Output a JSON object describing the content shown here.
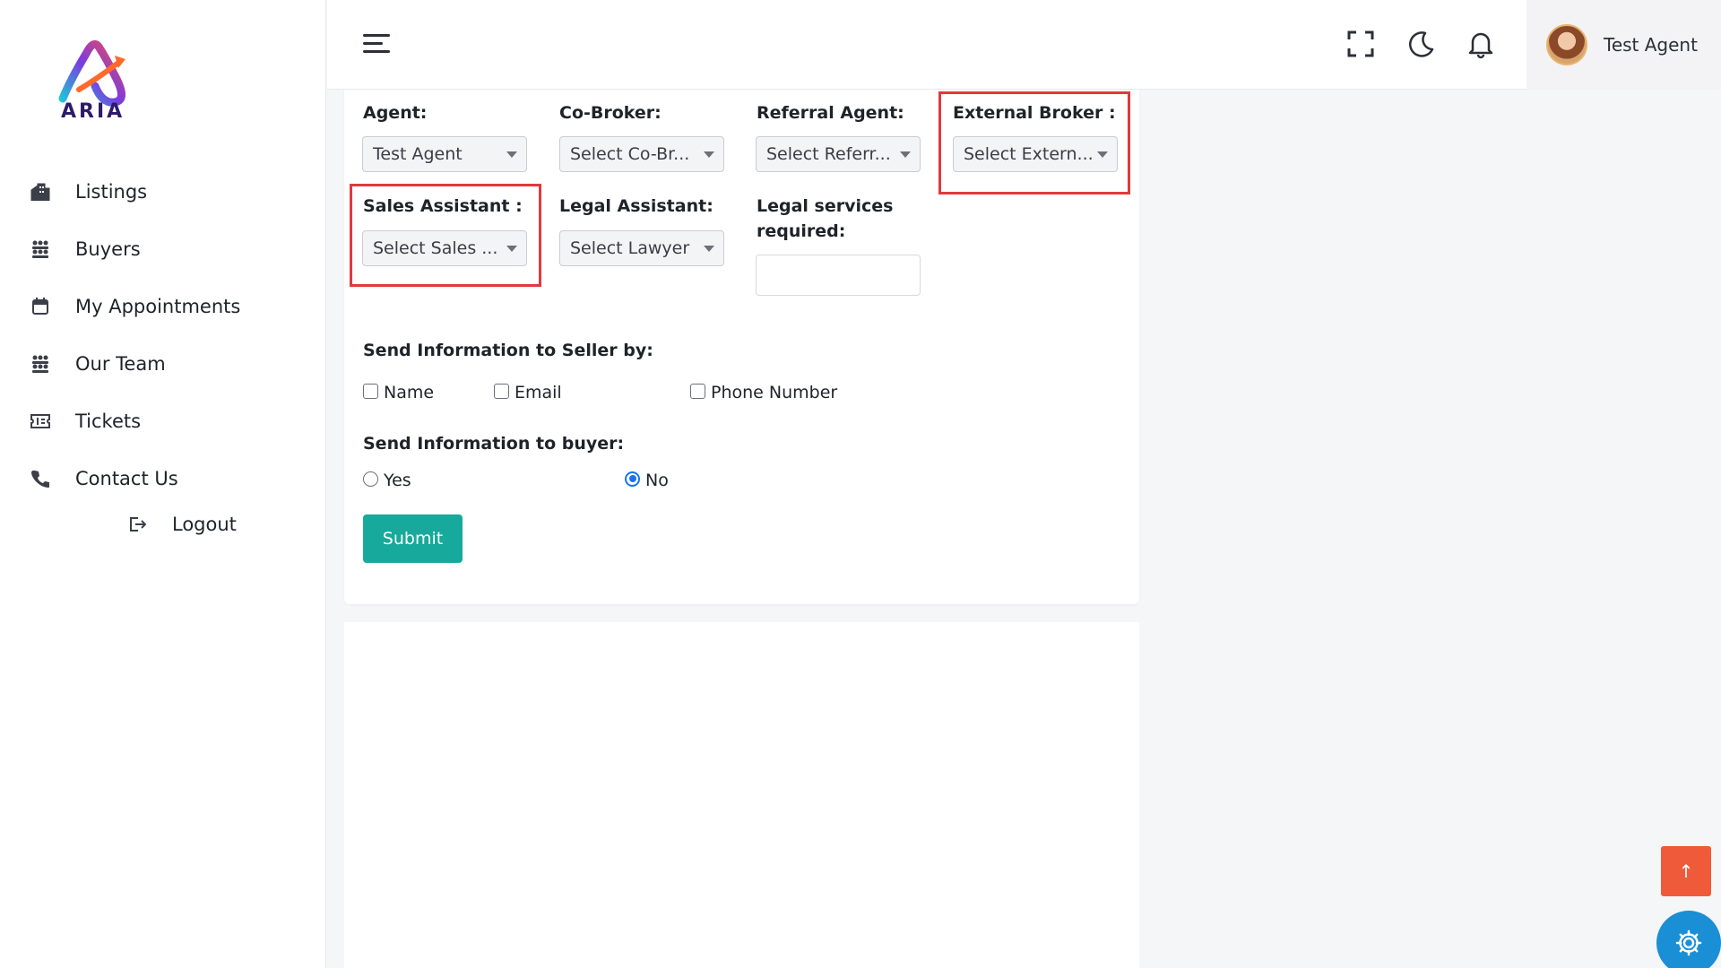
{
  "brand": {
    "logo_text": "ARIA"
  },
  "sidebar": {
    "items": [
      {
        "label": "Listings",
        "icon": "buildings-icon"
      },
      {
        "label": "Buyers",
        "icon": "team-icon"
      },
      {
        "label": "My Appointments",
        "icon": "calendar-icon"
      },
      {
        "label": "Our Team",
        "icon": "team-icon"
      },
      {
        "label": "Tickets",
        "icon": "ticket-icon"
      },
      {
        "label": "Contact Us",
        "icon": "phone-icon"
      }
    ],
    "logout": {
      "label": "Logout",
      "icon": "logout-icon"
    }
  },
  "header": {
    "icons": [
      "menu-icon",
      "fullscreen-icon",
      "moon-icon",
      "bell-icon"
    ],
    "user_name": "Test Agent"
  },
  "form": {
    "agent": {
      "label": "Agent:",
      "value": "Test Agent"
    },
    "co_broker": {
      "label": "Co-Broker:",
      "value": "Select Co-Br..."
    },
    "referral_agent": {
      "label": "Referral Agent:",
      "value": "Select Referr..."
    },
    "external_broker": {
      "label": "External Broker :",
      "value": "Select Extern..."
    },
    "sales_assistant": {
      "label": "Sales Assistant :",
      "value": "Select Sales ..."
    },
    "legal_assistant": {
      "label": "Legal Assistant:",
      "value": "Select Lawyer"
    },
    "legal_services": {
      "label_line1": "Legal services",
      "label_line2": "required:",
      "value": ""
    },
    "seller_info": {
      "title": "Send Information to Seller by:",
      "options": [
        {
          "label": "Name",
          "checked": false
        },
        {
          "label": "Email",
          "checked": false
        },
        {
          "label": "Phone Number",
          "checked": false
        }
      ]
    },
    "buyer_info": {
      "title": "Send Information to buyer:",
      "options": [
        {
          "label": "Yes",
          "selected": false
        },
        {
          "label": "No",
          "selected": true
        }
      ]
    },
    "submit_label": "Submit"
  },
  "colors": {
    "accent": "#17a99b",
    "highlight": "#e0393e",
    "scroll_top": "#ef5b3a",
    "settings_fab": "#1b8fd6",
    "radio_selected": "#1a73e8"
  },
  "fab": {
    "scroll_top_glyph": "↑"
  }
}
